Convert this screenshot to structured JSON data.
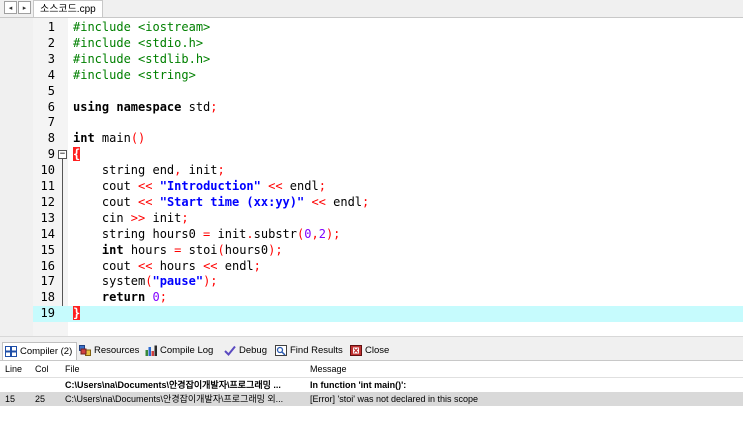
{
  "tab_bar": {
    "prev_symbol": "◂",
    "next_symbol": "▸",
    "file_tab_label": "소스코드.cpp"
  },
  "editor": {
    "lines": [
      {
        "n": "1",
        "segments": [
          {
            "t": "#include <iostream>",
            "c": "pp"
          }
        ]
      },
      {
        "n": "2",
        "segments": [
          {
            "t": "#include <stdio.h>",
            "c": "pp"
          }
        ]
      },
      {
        "n": "3",
        "segments": [
          {
            "t": "#include <stdlib.h>",
            "c": "pp"
          }
        ]
      },
      {
        "n": "4",
        "segments": [
          {
            "t": "#include <string>",
            "c": "pp"
          }
        ]
      },
      {
        "n": "5",
        "segments": []
      },
      {
        "n": "6",
        "segments": [
          {
            "t": "using namespace",
            "c": "kw"
          },
          {
            "t": " std",
            "c": ""
          },
          {
            "t": ";",
            "c": "op"
          }
        ]
      },
      {
        "n": "7",
        "segments": []
      },
      {
        "n": "8",
        "segments": [
          {
            "t": "int",
            "c": "kw"
          },
          {
            "t": " main",
            "c": ""
          },
          {
            "t": "()",
            "c": "op"
          }
        ]
      },
      {
        "n": "9",
        "fold": "start",
        "segments": [
          {
            "t": "{",
            "c": "brace-red"
          }
        ]
      },
      {
        "n": "10",
        "segments": [
          {
            "t": "    string end",
            "c": ""
          },
          {
            "t": ",",
            "c": "op"
          },
          {
            "t": " init",
            "c": ""
          },
          {
            "t": ";",
            "c": "op"
          }
        ]
      },
      {
        "n": "11",
        "segments": [
          {
            "t": "    cout ",
            "c": ""
          },
          {
            "t": "<<",
            "c": "op"
          },
          {
            "t": " ",
            "c": ""
          },
          {
            "t": "\"Introduction\"",
            "c": "str"
          },
          {
            "t": " ",
            "c": ""
          },
          {
            "t": "<<",
            "c": "op"
          },
          {
            "t": " endl",
            "c": ""
          },
          {
            "t": ";",
            "c": "op"
          }
        ]
      },
      {
        "n": "12",
        "segments": [
          {
            "t": "    cout ",
            "c": ""
          },
          {
            "t": "<<",
            "c": "op"
          },
          {
            "t": " ",
            "c": ""
          },
          {
            "t": "\"Start time (xx:yy)\"",
            "c": "str"
          },
          {
            "t": " ",
            "c": ""
          },
          {
            "t": "<<",
            "c": "op"
          },
          {
            "t": " endl",
            "c": ""
          },
          {
            "t": ";",
            "c": "op"
          }
        ]
      },
      {
        "n": "13",
        "segments": [
          {
            "t": "    cin ",
            "c": ""
          },
          {
            "t": ">>",
            "c": "op"
          },
          {
            "t": " init",
            "c": ""
          },
          {
            "t": ";",
            "c": "op"
          }
        ]
      },
      {
        "n": "14",
        "segments": [
          {
            "t": "    string hours0 ",
            "c": ""
          },
          {
            "t": "=",
            "c": "op"
          },
          {
            "t": " init",
            "c": ""
          },
          {
            "t": ".",
            "c": "op"
          },
          {
            "t": "substr",
            "c": ""
          },
          {
            "t": "(",
            "c": "op"
          },
          {
            "t": "0",
            "c": "num"
          },
          {
            "t": ",",
            "c": "op"
          },
          {
            "t": "2",
            "c": "num"
          },
          {
            "t": ");",
            "c": "op"
          }
        ]
      },
      {
        "n": "15",
        "segments": [
          {
            "t": "    ",
            "c": ""
          },
          {
            "t": "int",
            "c": "kw"
          },
          {
            "t": " hours ",
            "c": ""
          },
          {
            "t": "=",
            "c": "op"
          },
          {
            "t": " stoi",
            "c": ""
          },
          {
            "t": "(",
            "c": "op"
          },
          {
            "t": "hours0",
            "c": ""
          },
          {
            "t": ");",
            "c": "op"
          }
        ]
      },
      {
        "n": "16",
        "segments": [
          {
            "t": "    cout ",
            "c": ""
          },
          {
            "t": "<<",
            "c": "op"
          },
          {
            "t": " hours ",
            "c": ""
          },
          {
            "t": "<<",
            "c": "op"
          },
          {
            "t": " endl",
            "c": ""
          },
          {
            "t": ";",
            "c": "op"
          }
        ]
      },
      {
        "n": "17",
        "segments": [
          {
            "t": "    system",
            "c": ""
          },
          {
            "t": "(",
            "c": "op"
          },
          {
            "t": "\"pause\"",
            "c": "str"
          },
          {
            "t": ");",
            "c": "op"
          }
        ]
      },
      {
        "n": "18",
        "segments": [
          {
            "t": "    ",
            "c": ""
          },
          {
            "t": "return",
            "c": "kw"
          },
          {
            "t": " ",
            "c": ""
          },
          {
            "t": "0",
            "c": "num"
          },
          {
            "t": ";",
            "c": "op"
          }
        ]
      },
      {
        "n": "19",
        "fold": "end",
        "highlight": true,
        "segments": [
          {
            "t": "}",
            "c": "brace-red"
          }
        ]
      }
    ]
  },
  "panel_tabs": [
    {
      "label": "Compiler (2)",
      "icon": "compiler-grid-icon",
      "active": true
    },
    {
      "label": "Resources",
      "icon": "resources-icon",
      "active": false
    },
    {
      "label": "Compile Log",
      "icon": "bar-chart-icon",
      "active": false
    },
    {
      "label": "Debug",
      "icon": "debug-check-icon",
      "active": false
    },
    {
      "label": "Find Results",
      "icon": "find-results-icon",
      "active": false
    },
    {
      "label": "Close",
      "icon": "close-panel-icon",
      "active": false
    }
  ],
  "messages": {
    "columns": [
      "Line",
      "Col",
      "File",
      "Message"
    ],
    "rows": [
      {
        "line": "",
        "col": "",
        "file": "C:\\Users\\na\\Documents\\안경잡이개발자\\프로그래밍 ...",
        "message": "In function 'int main()':",
        "bold": true,
        "selected": false
      },
      {
        "line": "15",
        "col": "25",
        "file": "C:\\Users\\na\\Documents\\안경잡이개발자\\프로그래밍 외...",
        "message": "[Error] 'stoi' was not declared in this scope",
        "bold": false,
        "selected": true
      }
    ]
  },
  "colors": {
    "highlight_line": "#c6fbfd",
    "brace_highlight": "#ff2020",
    "preprocessor": "#008000",
    "string": "#0000ff",
    "operator": "#ff0000",
    "number": "#8000ff"
  }
}
